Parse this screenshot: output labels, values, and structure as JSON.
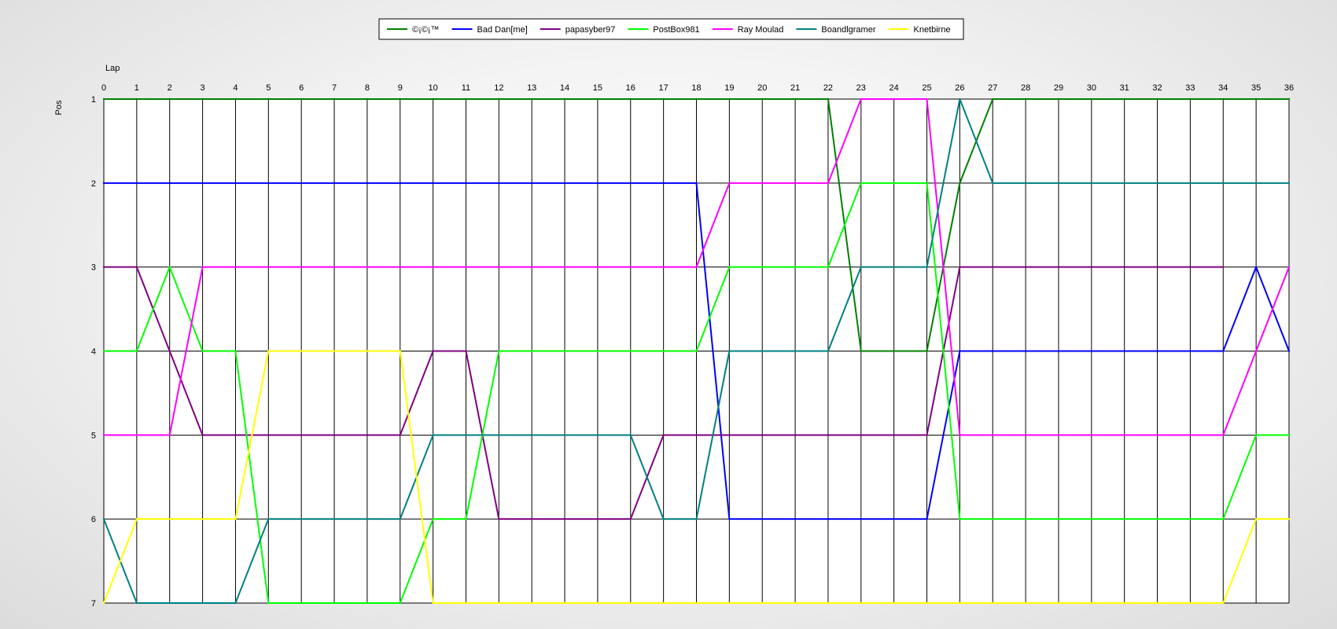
{
  "chart_data": {
    "type": "line",
    "xlabel": "Lap",
    "ylabel": "Pos",
    "xlim": [
      0,
      36
    ],
    "ylim": [
      1,
      7
    ],
    "y_inverted": true,
    "grid": true,
    "legend_position": "top-center",
    "x": [
      0,
      1,
      2,
      3,
      4,
      5,
      6,
      7,
      8,
      9,
      10,
      11,
      12,
      13,
      14,
      15,
      16,
      17,
      18,
      19,
      20,
      21,
      22,
      23,
      24,
      25,
      26,
      27,
      28,
      29,
      30,
      31,
      32,
      33,
      34,
      35,
      36
    ],
    "x_ticks": [
      "0",
      "1",
      "2",
      "3",
      "4",
      "5",
      "6",
      "7",
      "8",
      "9",
      "10",
      "11",
      "12",
      "13",
      "14",
      "15",
      "16",
      "17",
      "18",
      "19",
      "20",
      "21",
      "22",
      "23",
      "24",
      "25",
      "26",
      "27",
      "28",
      "29",
      "30",
      "31",
      "32",
      "33",
      "34",
      "35",
      "36"
    ],
    "y_ticks": [
      "1",
      "2",
      "3",
      "4",
      "5",
      "6",
      "7"
    ],
    "series": [
      {
        "name": "©¡©¡™",
        "color": "#008000",
        "values": [
          1,
          1,
          1,
          1,
          1,
          1,
          1,
          1,
          1,
          1,
          1,
          1,
          1,
          1,
          1,
          1,
          1,
          1,
          1,
          1,
          1,
          1,
          1,
          4,
          4,
          4,
          2,
          1,
          1,
          1,
          1,
          1,
          1,
          1,
          1,
          1,
          1
        ]
      },
      {
        "name": "Bad Dan[me]",
        "color": "#0000ff",
        "values": [
          2,
          2,
          2,
          2,
          2,
          2,
          2,
          2,
          2,
          2,
          2,
          2,
          2,
          2,
          2,
          2,
          2,
          2,
          2,
          6,
          6,
          6,
          6,
          6,
          6,
          6,
          4,
          4,
          4,
          4,
          4,
          4,
          4,
          4,
          4,
          3,
          4
        ]
      },
      {
        "name": "papasyber97",
        "color": "#800080",
        "values": [
          3,
          3,
          4,
          5,
          5,
          5,
          5,
          5,
          5,
          5,
          4,
          4,
          6,
          6,
          6,
          6,
          6,
          5,
          5,
          5,
          5,
          5,
          5,
          5,
          5,
          5,
          3,
          3,
          3,
          3,
          3,
          3,
          3,
          3,
          3,
          null,
          null
        ]
      },
      {
        "name": "PostBox981",
        "color": "#00ff00",
        "values": [
          4,
          4,
          3,
          4,
          4,
          7,
          7,
          7,
          7,
          7,
          6,
          6,
          4,
          4,
          4,
          4,
          4,
          4,
          4,
          3,
          3,
          3,
          3,
          2,
          2,
          2,
          6,
          6,
          6,
          6,
          6,
          6,
          6,
          6,
          6,
          5,
          5
        ]
      },
      {
        "name": "Ray Moulad",
        "color": "#ff00ff",
        "values": [
          5,
          5,
          5,
          3,
          3,
          3,
          3,
          3,
          3,
          3,
          3,
          3,
          3,
          3,
          3,
          3,
          3,
          3,
          3,
          2,
          2,
          2,
          2,
          1,
          1,
          1,
          5,
          5,
          5,
          5,
          5,
          5,
          5,
          5,
          5,
          4,
          3
        ]
      },
      {
        "name": "Boandlgramer",
        "color": "#008080",
        "values": [
          6,
          7,
          7,
          7,
          7,
          6,
          6,
          6,
          6,
          6,
          5,
          5,
          5,
          5,
          5,
          5,
          5,
          6,
          6,
          4,
          4,
          4,
          4,
          3,
          3,
          3,
          1,
          2,
          2,
          2,
          2,
          2,
          2,
          2,
          2,
          2,
          2
        ]
      },
      {
        "name": "Knetbirne",
        "color": "#ffff00",
        "values": [
          7,
          6,
          6,
          6,
          6,
          4,
          4,
          4,
          4,
          4,
          7,
          7,
          7,
          7,
          7,
          7,
          7,
          7,
          7,
          7,
          7,
          7,
          7,
          7,
          7,
          7,
          7,
          7,
          7,
          7,
          7,
          7,
          7,
          7,
          7,
          6,
          6
        ]
      }
    ]
  }
}
